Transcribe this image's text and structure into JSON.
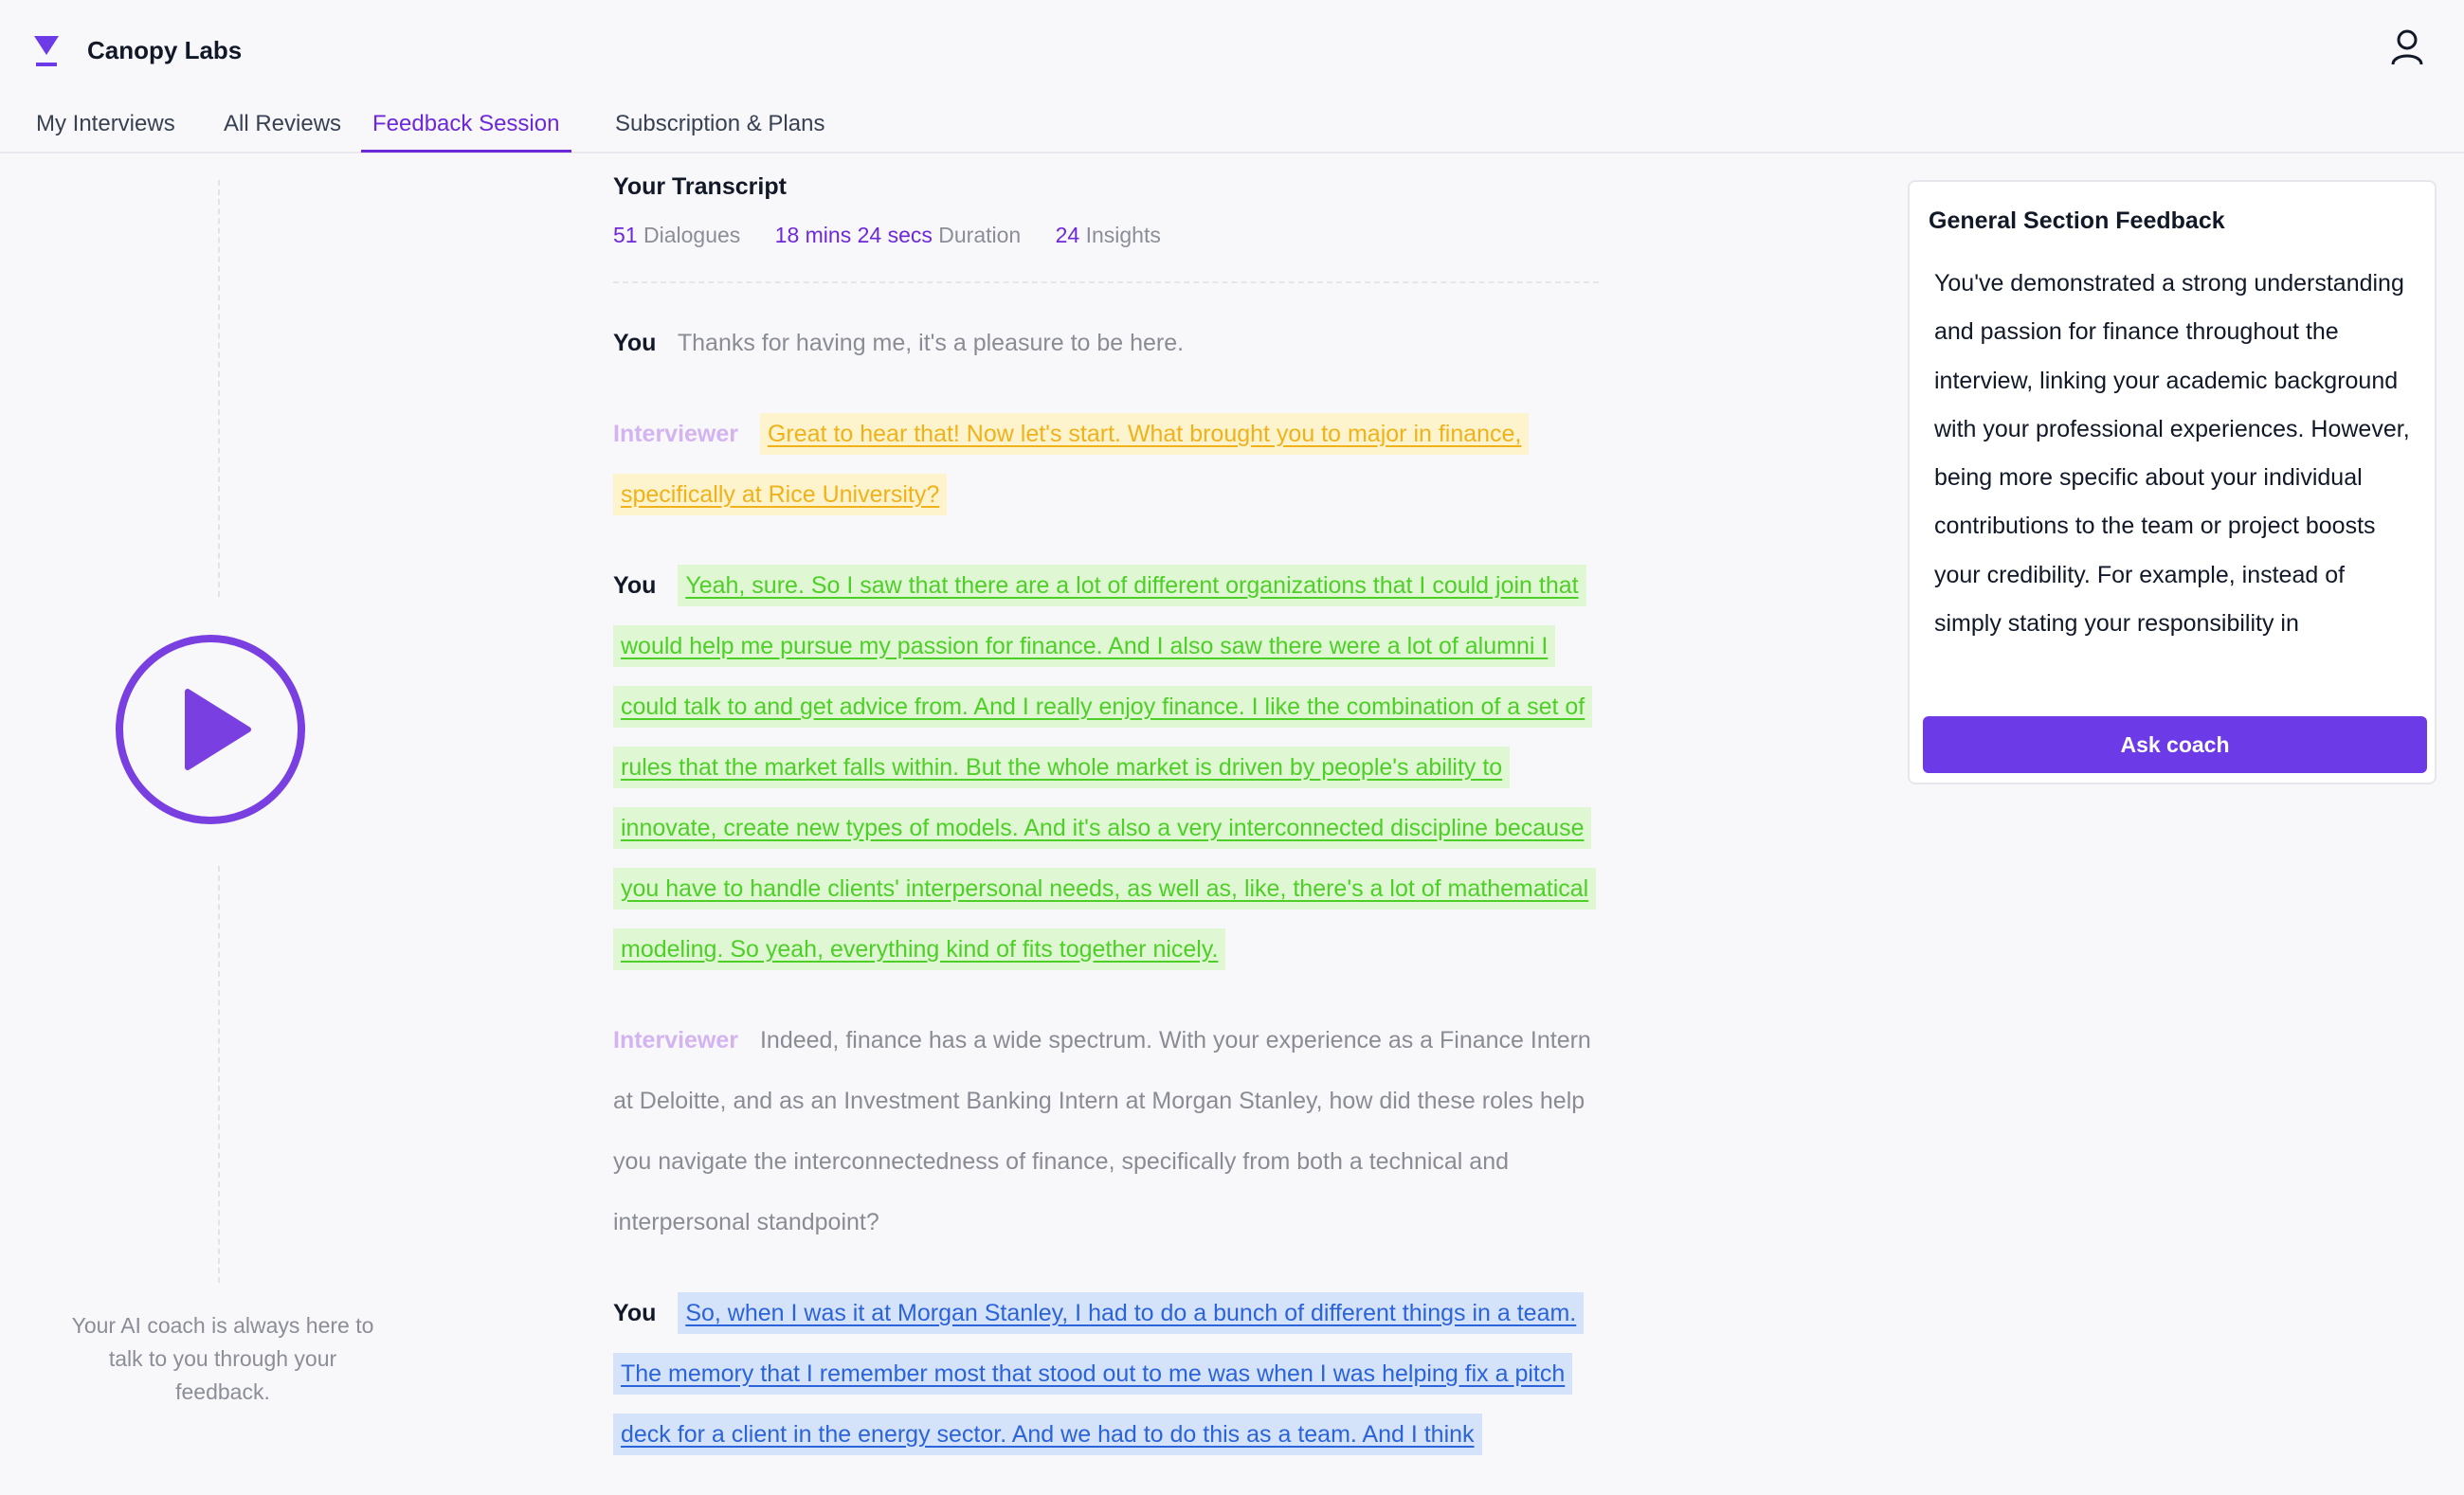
{
  "app": {
    "brand_name": "Canopy Labs",
    "accent_color": "#6d28d9"
  },
  "header": {
    "icons": {
      "logo": "canopy-logo-icon",
      "user": "user-profile-icon"
    },
    "tabs": [
      {
        "label": "My Interviews",
        "active": false
      },
      {
        "label": "All Reviews",
        "active": false
      },
      {
        "label": "Feedback Session",
        "active": true
      },
      {
        "label": "Subscription & Plans",
        "active": false
      }
    ]
  },
  "left_rail": {
    "play_icon": "play-icon",
    "coach_note": "Your AI coach is always here to talk to you through your feedback."
  },
  "transcript": {
    "title": "Your Transcript",
    "stats": [
      {
        "value": "51",
        "label": "Dialogues"
      },
      {
        "value": "18 mins 24 secs",
        "label": "Duration"
      },
      {
        "value": "24",
        "label": "Insights"
      }
    ],
    "dialogues": [
      {
        "speaker": "You",
        "speaker_type": "you",
        "highlight": "none",
        "text": "Thanks for having me, it's a pleasure to be here."
      },
      {
        "speaker": "Interviewer",
        "speaker_type": "interviewer",
        "highlight": "yellow",
        "text": "Great to hear that! Now let's start. What brought you to major in finance, specifically at Rice University?"
      },
      {
        "speaker": "You",
        "speaker_type": "you",
        "highlight": "green",
        "text": "Yeah, sure. So I saw that there are a lot of different organizations that I could join that would help me pursue my passion for finance. And I also saw there were a lot of alumni I could talk to and get advice from. And I really enjoy finance. I like the combination of a set of rules that the market falls within. But the whole market is driven by people's ability to innovate, create new types of models. And it's also a very interconnected discipline because you have to handle clients' interpersonal needs, as well as, like, there's a lot of mathematical modeling. So yeah, everything kind of fits together nicely."
      },
      {
        "speaker": "Interviewer",
        "speaker_type": "interviewer",
        "highlight": "none",
        "text": "Indeed, finance has a wide spectrum. With your experience as a Finance Intern at Deloitte, and as an Investment Banking Intern at Morgan Stanley, how did these roles help you navigate the interconnectedness of finance, specifically from both a technical and interpersonal standpoint?"
      },
      {
        "speaker": "You",
        "speaker_type": "you",
        "highlight": "blue",
        "text": "So, when I was it at Morgan Stanley, I had to do a bunch of different things in a team. The memory that I remember most that stood out to me was when I was helping fix a pitch deck for a client in the energy sector. And we had to do this as a team. And I think"
      }
    ],
    "highlight_colors": {
      "yellow": "#fdf3cd",
      "green": "#dff8d3",
      "blue": "#d5e3fa"
    }
  },
  "feedback_card": {
    "title": "General Section Feedback",
    "body": "You've demonstrated a strong understanding and passion for finance throughout the interview, linking your academic background with your professional experiences. However, being more specific about your individual contributions to the team or project boosts your credibility. For example, instead of simply stating your responsibility in",
    "button_label": "Ask coach"
  }
}
